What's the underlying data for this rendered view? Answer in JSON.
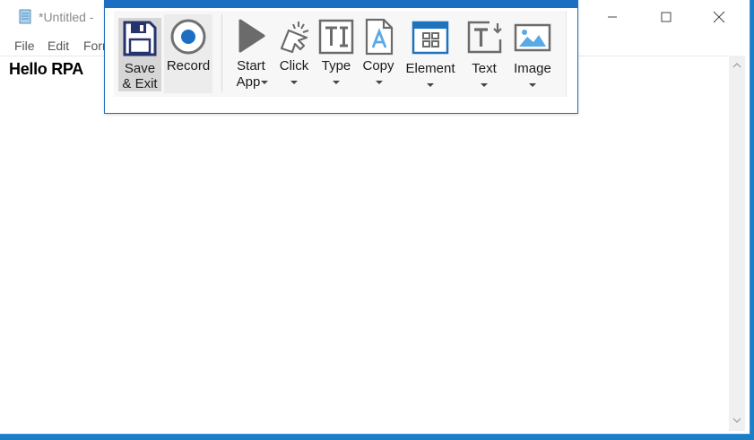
{
  "notepad": {
    "title": "*Untitled -",
    "menu": [
      "File",
      "Edit",
      "Form"
    ],
    "content": "Hello RPA"
  },
  "toolbar": {
    "buttons": {
      "save_exit": {
        "line1": "Save",
        "line2": "& Exit",
        "icon": "floppy-disk-icon"
      },
      "record": {
        "label": "Record",
        "icon": "record-icon"
      },
      "start_app": {
        "line1": "Start",
        "line2": "App",
        "icon": "play-icon"
      },
      "click": {
        "label": "Click",
        "icon": "pointer-click-icon"
      },
      "type": {
        "label": "Type",
        "icon": "text-input-icon"
      },
      "copy": {
        "label": "Copy",
        "icon": "document-copy-icon"
      },
      "element": {
        "label": "Element",
        "icon": "window-element-icon"
      },
      "text": {
        "label": "Text",
        "icon": "text-extract-icon"
      },
      "image": {
        "label": "Image",
        "icon": "image-icon"
      }
    }
  },
  "colors": {
    "desktop": "#1a7fc7",
    "toolbar_accent": "#1b6ec2",
    "record_blue": "#1b6ec2",
    "selected_bg": "#d6d6d6",
    "icon_gray": "#707070",
    "icon_blue": "#1e73be"
  }
}
